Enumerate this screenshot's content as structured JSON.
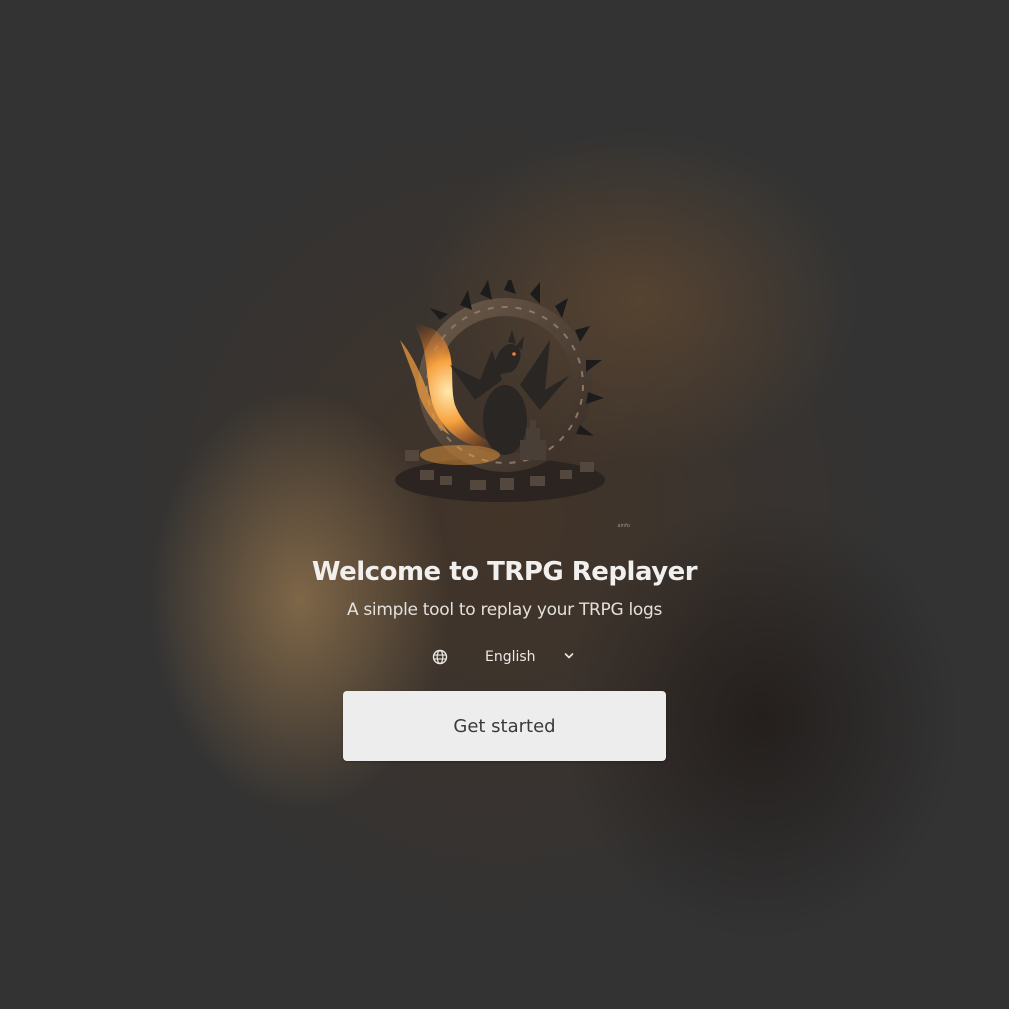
{
  "welcome": {
    "title": "Welcome to TRPG Replayer",
    "subtitle": "A simple tool to replay your TRPG logs"
  },
  "logo": {
    "icon": "dragon-logo-icon",
    "watermark": "ainfo"
  },
  "language": {
    "icon": "globe-icon",
    "selected": "English",
    "dropdown_icon": "chevron-down-icon"
  },
  "cta": {
    "label": "Get started"
  },
  "colors": {
    "background": "#333333",
    "button": "#ededed",
    "button_text": "#3a3a3a",
    "text": "#f2f0ee",
    "fire": "#f5a040"
  }
}
